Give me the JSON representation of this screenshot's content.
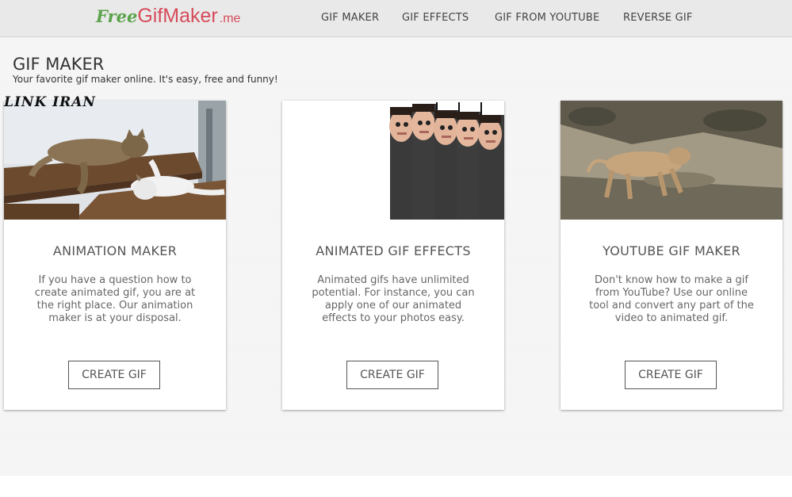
{
  "logo": {
    "free": "Free",
    "gif": "Gif",
    "maker": "Maker",
    "me": ".me"
  },
  "nav": [
    {
      "label": "GIF MAKER"
    },
    {
      "label": "GIF EFFECTS"
    },
    {
      "label": "GIF FROM YOUTUBE"
    },
    {
      "label": "REVERSE GIF"
    }
  ],
  "page": {
    "title": "GIF MAKER",
    "subtitle": "Your favorite gif maker online. It's easy, free and funny!"
  },
  "watermark": "LINK IRAN",
  "cards": [
    {
      "title": "ANIMATION MAKER",
      "text": "If you have a question how to create animated gif, you are at the right place. Our animation maker is at your disposal.",
      "button": "CREATE GIF",
      "image": "cats-animation"
    },
    {
      "title": "ANIMATED GIF EFFECTS",
      "text": "Animated gifs have unlimited potential. For instance, you can apply one of our animated effects to your photos easy.",
      "button": "CREATE GIF",
      "image": "face-effect-animation"
    },
    {
      "title": "YOUTUBE GIF MAKER",
      "text": "Don't know how to make a gif from YouTube? Use our online tool and convert any part of the video to animated gif.",
      "button": "CREATE GIF",
      "image": "lioness-video-frame"
    }
  ],
  "colors": {
    "accent_green": "#5aa34a",
    "accent_red": "#d64b5a",
    "navbar": "#e9e9e9"
  }
}
